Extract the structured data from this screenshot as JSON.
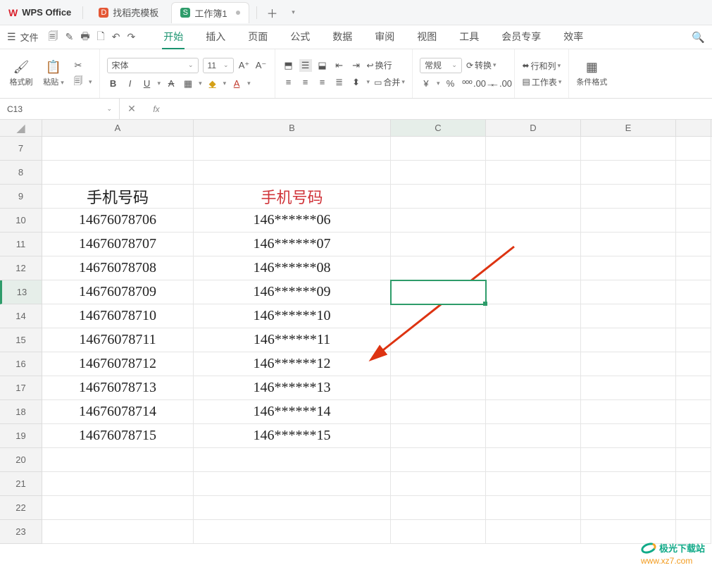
{
  "app": {
    "name": "WPS Office"
  },
  "tabs": [
    {
      "label": "找稻壳模板",
      "icon": "D"
    },
    {
      "label": "工作簿1",
      "icon": "S",
      "active": true
    }
  ],
  "menubar": {
    "file": "文件"
  },
  "menutabs": [
    "开始",
    "插入",
    "页面",
    "公式",
    "数据",
    "审阅",
    "视图",
    "工具",
    "会员专享",
    "效率"
  ],
  "active_menutab": 0,
  "ribbon": {
    "format_painter": "格式刷",
    "paste": "粘贴",
    "font_name": "宋体",
    "font_size": "11",
    "wrap": "换行",
    "merge": "合并",
    "general": "常规",
    "convert": "转换",
    "rowcol": "行和列",
    "worksheet": "工作表",
    "condfmt": "条件格式"
  },
  "namebox": "C13",
  "formula": "",
  "columns": [
    "A",
    "B",
    "C",
    "D",
    "E"
  ],
  "selected_col": "C",
  "row_start": 7,
  "rows": [
    {
      "n": 7,
      "A": "",
      "B": ""
    },
    {
      "n": 8,
      "A": "",
      "B": ""
    },
    {
      "n": 9,
      "A": "手机号码",
      "B": "手机号码",
      "header": true
    },
    {
      "n": 10,
      "A": "14676078706",
      "B": "146******06"
    },
    {
      "n": 11,
      "A": "14676078707",
      "B": "146******07"
    },
    {
      "n": 12,
      "A": "14676078708",
      "B": "146******08"
    },
    {
      "n": 13,
      "A": "14676078709",
      "B": "146******09",
      "selected_row": true
    },
    {
      "n": 14,
      "A": "14676078710",
      "B": "146******10"
    },
    {
      "n": 15,
      "A": "14676078711",
      "B": "146******11"
    },
    {
      "n": 16,
      "A": "14676078712",
      "B": "146******12"
    },
    {
      "n": 17,
      "A": "14676078713",
      "B": "146******13"
    },
    {
      "n": 18,
      "A": "14676078714",
      "B": "146******14"
    },
    {
      "n": 19,
      "A": "14676078715",
      "B": "146******15"
    },
    {
      "n": 20,
      "A": "",
      "B": ""
    },
    {
      "n": 21,
      "A": "",
      "B": ""
    },
    {
      "n": 22,
      "A": "",
      "B": ""
    },
    {
      "n": 23,
      "A": "",
      "B": ""
    }
  ],
  "selected_cell": "C13",
  "watermark": {
    "line1": "极光下载站",
    "line2": "www.xz7.com"
  }
}
